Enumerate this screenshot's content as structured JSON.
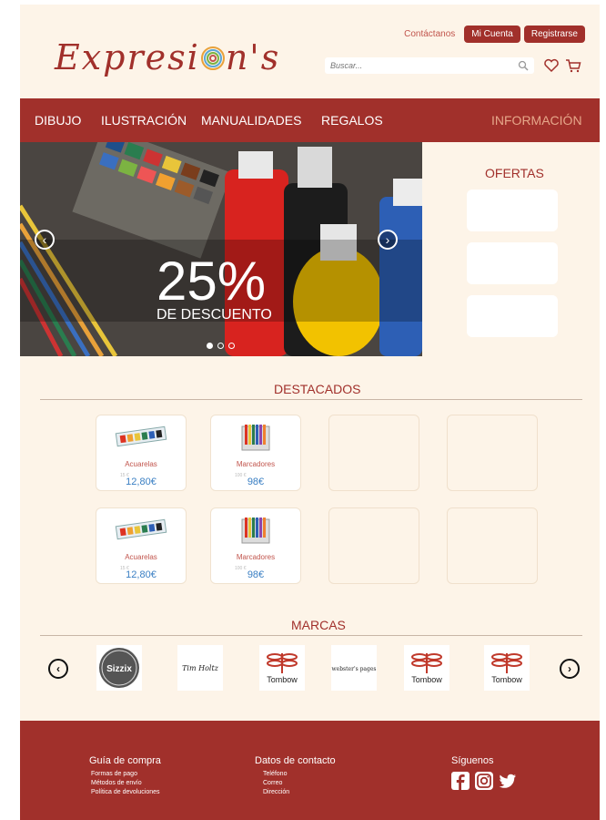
{
  "header": {
    "logo_text_1": "Expresi",
    "logo_text_2": "n's",
    "contact_link": "Contáctanos",
    "account_button": "Mi Cuenta",
    "register_button": "Registrarse",
    "search_placeholder": "Buscar..."
  },
  "nav": {
    "items": [
      "DIBUJO",
      "ILUSTRACIÓN",
      "MANUALIDADES",
      "REGALOS"
    ],
    "info": "INFORMACIÓN"
  },
  "hero": {
    "headline": "25%",
    "subline": "DE DESCUENTO",
    "prev": "‹",
    "next": "›"
  },
  "ofertas": {
    "title": "OFERTAS"
  },
  "destacados": {
    "title": "DESTACADOS",
    "products": [
      {
        "name": "Acuarelas",
        "old_price": "15 €",
        "price": "12,80€"
      },
      {
        "name": "Marcadores",
        "old_price": "100 €",
        "price": "98€"
      },
      {
        "name": "Acuarelas",
        "old_price": "15 €",
        "price": "12,80€"
      },
      {
        "name": "Marcadores",
        "old_price": "100 €",
        "price": "98€"
      }
    ]
  },
  "marcas": {
    "title": "MARCAS",
    "brands": [
      "Sizzix",
      "Tim Holtz",
      "Tombow",
      "webster's pages",
      "Tombow",
      "Tombow"
    ],
    "prev": "‹",
    "next": "›"
  },
  "footer": {
    "guide_title": "Guía de compra",
    "guide_items": [
      "Formas de pago",
      "Métodos de envío",
      "Política de devoluciones"
    ],
    "contact_title": "Datos de contacto",
    "contact_items": [
      "Teléfono",
      "Correo",
      "Dirección"
    ],
    "social_title": "Síguenos",
    "social_icons": [
      "facebook-icon",
      "instagram-icon",
      "twitter-icon"
    ]
  },
  "colors": {
    "brand_red": "#a1302b",
    "background": "#fdf4e8",
    "price_blue": "#3a7fc3"
  }
}
